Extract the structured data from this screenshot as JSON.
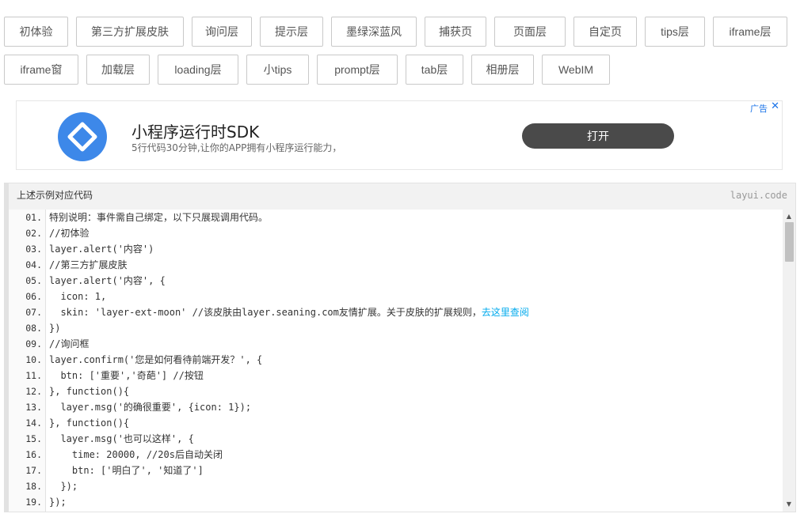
{
  "buttons_row1": [
    "初体验",
    "第三方扩展皮肤",
    "询问层",
    "提示层",
    "墨绿深蓝风",
    "捕获页",
    "页面层",
    "自定页",
    "tips层",
    "iframe层"
  ],
  "buttons_row2": [
    "iframe窗",
    "加载层",
    "loading层",
    "小tips",
    "prompt层",
    "tab层",
    "相册层",
    "WebIM"
  ],
  "ad": {
    "icon": "app-logo-icon",
    "title": "小程序运行时SDK",
    "desc": "5行代码30分钟,让你的APP拥有小程序运行能力，",
    "open_label": "打开",
    "label": "广告",
    "close": "✕",
    "accent": "#3d88e9"
  },
  "code": {
    "title": "上述示例对应代码",
    "brand": "layui.code",
    "lines": [
      {
        "n": "01.",
        "t": "特别说明：事件需自己绑定，以下只展现调用代码。"
      },
      {
        "n": "02.",
        "t": "//初体验"
      },
      {
        "n": "03.",
        "t": "layer.alert('内容')"
      },
      {
        "n": "04.",
        "t": "//第三方扩展皮肤"
      },
      {
        "n": "05.",
        "t": "layer.alert('内容', {"
      },
      {
        "n": "06.",
        "t": "  icon: 1,"
      },
      {
        "n": "07.",
        "t": "  skin: 'layer-ext-moon' //该皮肤由layer.seaning.com友情扩展。关于皮肤的扩展规则，",
        "link": "去这里查阅"
      },
      {
        "n": "08.",
        "t": "})"
      },
      {
        "n": "09.",
        "t": "//询问框"
      },
      {
        "n": "10.",
        "t": "layer.confirm('您是如何看待前端开发？', {"
      },
      {
        "n": "11.",
        "t": "  btn: ['重要','奇葩'] //按钮"
      },
      {
        "n": "12.",
        "t": "}, function(){"
      },
      {
        "n": "13.",
        "t": "  layer.msg('的确很重要', {icon: 1});"
      },
      {
        "n": "14.",
        "t": "}, function(){"
      },
      {
        "n": "15.",
        "t": "  layer.msg('也可以这样', {"
      },
      {
        "n": "16.",
        "t": "    time: 20000, //20s后自动关闭"
      },
      {
        "n": "17.",
        "t": "    btn: ['明白了', '知道了']"
      },
      {
        "n": "18.",
        "t": "  });"
      },
      {
        "n": "19.",
        "t": "});"
      }
    ]
  },
  "scrollbar": {
    "up": "▲",
    "down": "▼"
  }
}
